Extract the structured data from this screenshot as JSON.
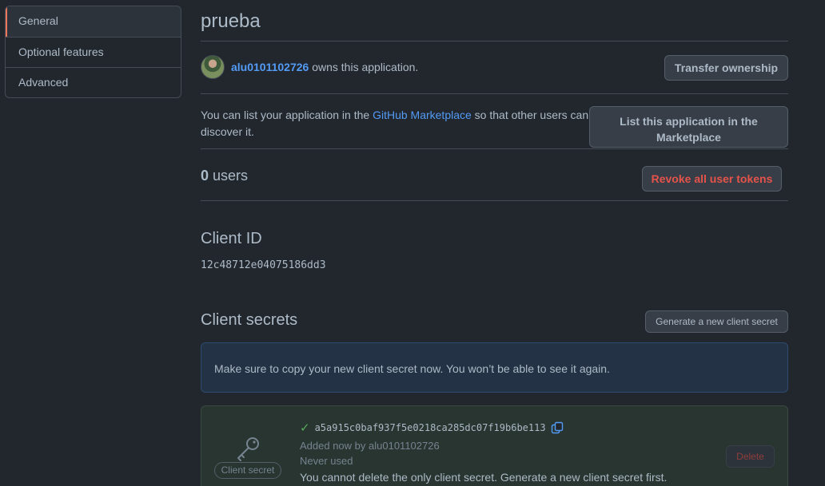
{
  "sidebar": {
    "items": [
      {
        "label": "General",
        "selected": true
      },
      {
        "label": "Optional features",
        "selected": false
      },
      {
        "label": "Advanced",
        "selected": false
      }
    ]
  },
  "app": {
    "name": "prueba",
    "owner_user": "alu0101102726",
    "owner_suffix": " owns this application.",
    "transfer_button": "Transfer ownership",
    "marketplace_text_before": "You can list your application in the ",
    "marketplace_link": "GitHub Marketplace",
    "marketplace_text_after": " so that other users can discover it.",
    "marketplace_button": "List this application in the Marketplace",
    "users_count": "0",
    "users_label": " users",
    "revoke_button": "Revoke all user tokens"
  },
  "client_id": {
    "heading": "Client ID",
    "value": "12c48712e04075186dd3"
  },
  "client_secrets": {
    "heading": "Client secrets",
    "generate_button": "Generate a new client secret",
    "flash_message": "Make sure to copy your new client secret now. You won’t be able to see it again.",
    "secret": {
      "badge": "Client secret",
      "check_symbol": "✓",
      "value": "a5a915c0baf937f5e0218ca285dc07f19b6be113",
      "added_prefix": "Added now by ",
      "added_by": "alu0101102726",
      "usage": "Never used",
      "warning": "You cannot delete the only client secret. Generate a new client secret first.",
      "delete_button": "Delete"
    }
  },
  "colors": {
    "background": "#22272e",
    "link": "#539bf5",
    "danger": "#e5534b",
    "success": "#57ab5a",
    "selected_accent": "#ec775c"
  }
}
